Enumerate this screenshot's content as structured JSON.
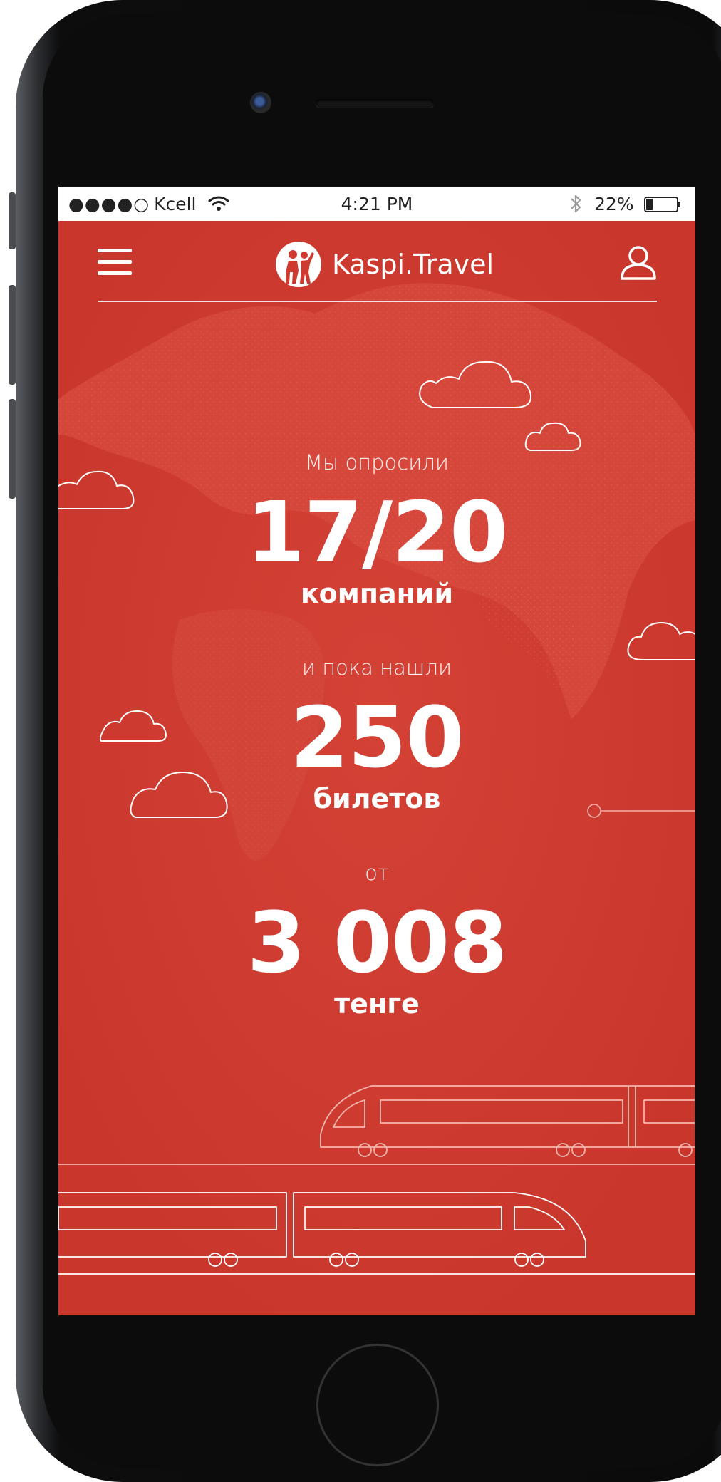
{
  "status_bar": {
    "signal": "●●●●○",
    "carrier": "Kcell",
    "time": "4:21 PM",
    "battery_percent": "22%",
    "battery_level": 0.22
  },
  "header": {
    "app_name": "Kaspi.Travel",
    "menu_icon": "hamburger-menu-icon",
    "profile_icon": "user-profile-icon"
  },
  "stats": {
    "companies": {
      "prefix": "Мы опросили",
      "value": "17/20",
      "unit": "компаний"
    },
    "tickets": {
      "prefix": "и пока нашли",
      "value": "250",
      "unit": "билетов"
    },
    "price": {
      "prefix": "от",
      "value": "3 008",
      "unit": "тенге"
    }
  },
  "colors": {
    "background": "#d0392f",
    "background_light": "#d9463a",
    "text": "#ffffff",
    "line": "#f5c6c1"
  }
}
